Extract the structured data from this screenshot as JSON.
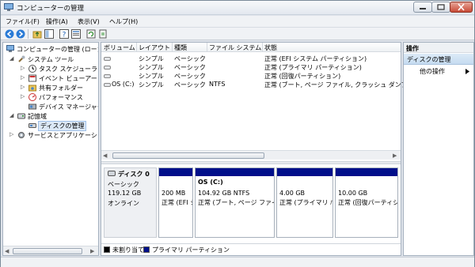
{
  "window": {
    "title": "コンピューターの管理"
  },
  "menu": [
    "ファイル(F)",
    "操作(A)",
    "表示(V)",
    "ヘルプ(H)"
  ],
  "tree": {
    "items": [
      {
        "label": "コンピューターの管理 (ローカ",
        "icon": "computer-icon"
      },
      {
        "label": "システム ツール",
        "icon": "tools-icon"
      },
      {
        "label": "タスク スケジューラ",
        "icon": "clock-icon"
      },
      {
        "label": "イベント ビューアー",
        "icon": "event-viewer-icon"
      },
      {
        "label": "共有フォルダー",
        "icon": "shared-folder-icon"
      },
      {
        "label": "パフォーマンス",
        "icon": "performance-icon"
      },
      {
        "label": "デバイス マネージャー",
        "icon": "device-manager-icon"
      },
      {
        "label": "記憶域",
        "icon": "storage-icon"
      },
      {
        "label": "ディスクの管理",
        "icon": "disk-icon"
      },
      {
        "label": "サービスとアプリケーション",
        "icon": "services-icon"
      }
    ]
  },
  "volumes": {
    "headers": [
      "ボリューム",
      "レイアウト",
      "種類",
      "ファイル システム",
      "状態"
    ],
    "rows": [
      {
        "volume": "",
        "layout": "シンプル",
        "type": "ベーシック",
        "fs": "",
        "status": "正常 (EFI システム パーティション)"
      },
      {
        "volume": "",
        "layout": "シンプル",
        "type": "ベーシック",
        "fs": "",
        "status": "正常 (プライマリ パーティション)"
      },
      {
        "volume": "",
        "layout": "シンプル",
        "type": "ベーシック",
        "fs": "",
        "status": "正常 (回復パーティション)"
      },
      {
        "volume": "OS (C:)",
        "layout": "シンプル",
        "type": "ベーシック",
        "fs": "NTFS",
        "status": "正常 (ブート, ページ ファイル, クラッシュ ダンプ, プ"
      }
    ]
  },
  "disk": {
    "name": "ディスク 0",
    "type": "ベーシック",
    "size": "119.12 GB",
    "state": "オンライン",
    "partitions": [
      {
        "title": "",
        "size": "200 MB",
        "status": "正常 (EFI シ"
      },
      {
        "title": "OS  (C:)",
        "size": "104.92 GB NTFS",
        "status": "正常 (ブート, ページ ファイ"
      },
      {
        "title": "",
        "size": "4.00 GB",
        "status": "正常 (プライマリ ﾊ"
      },
      {
        "title": "",
        "size": "10.00 GB",
        "status": "正常 (回復パーティシ"
      }
    ]
  },
  "legend": {
    "unallocated": "未割り当て",
    "primary": "プライマリ パーティション"
  },
  "actions": {
    "title": "操作",
    "section": "ディスクの管理",
    "other": "他の操作"
  },
  "colors": {
    "primary_partition": "#000f8a",
    "unallocated": "#000000"
  }
}
